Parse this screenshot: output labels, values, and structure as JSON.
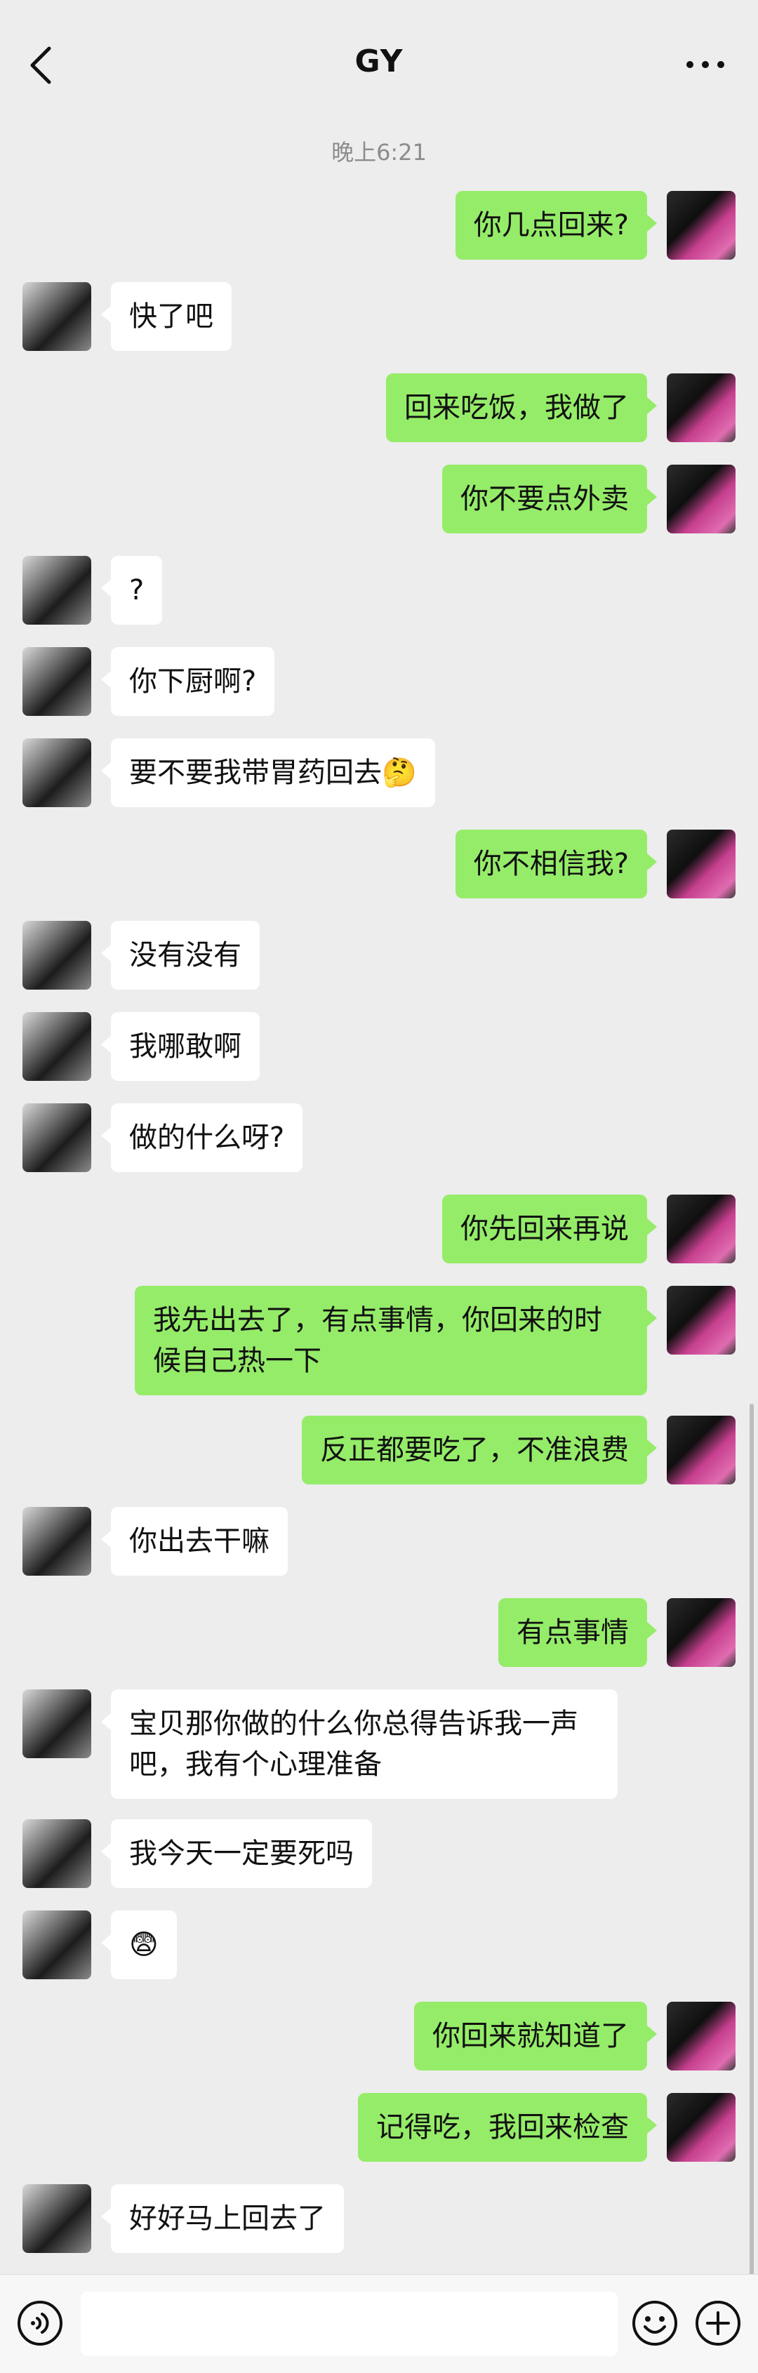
{
  "header": {
    "title": "GY"
  },
  "chat": {
    "timestamp": "晚上6:21",
    "messages": [
      {
        "side": "out",
        "text": "你几点回来?"
      },
      {
        "side": "in",
        "text": "快了吧"
      },
      {
        "side": "out",
        "text": "回来吃饭，我做了"
      },
      {
        "side": "out",
        "text": "你不要点外卖"
      },
      {
        "side": "in",
        "text": "?"
      },
      {
        "side": "in",
        "text": "你下厨啊?"
      },
      {
        "side": "in",
        "text": "要不要我带胃药回去🤔"
      },
      {
        "side": "out",
        "text": "你不相信我?"
      },
      {
        "side": "in",
        "text": "没有没有"
      },
      {
        "side": "in",
        "text": "我哪敢啊"
      },
      {
        "side": "in",
        "text": "做的什么呀?"
      },
      {
        "side": "out",
        "text": "你先回来再说"
      },
      {
        "side": "out",
        "text": "我先出去了，有点事情，你回来的时候自己热一下"
      },
      {
        "side": "out",
        "text": "反正都要吃了，不准浪费"
      },
      {
        "side": "in",
        "text": "你出去干嘛"
      },
      {
        "side": "out",
        "text": "有点事情"
      },
      {
        "side": "in",
        "text": "宝贝那你做的什么你总得告诉我一声吧，我有个心理准备"
      },
      {
        "side": "in",
        "text": "我今天一定要死吗"
      },
      {
        "side": "in",
        "text": "😨"
      },
      {
        "side": "out",
        "text": "你回来就知道了"
      },
      {
        "side": "out",
        "text": "记得吃，我回来检查"
      },
      {
        "side": "in",
        "text": "好好马上回去了"
      }
    ]
  },
  "input": {
    "value": "",
    "placeholder": ""
  },
  "colors": {
    "background": "#ededed",
    "outgoing_bubble": "#95ec69",
    "incoming_bubble": "#ffffff"
  },
  "icons": {
    "back": "chevron-left-icon",
    "more": "more-dots-icon",
    "voice": "voice-icon",
    "emoji": "emoji-icon",
    "plus": "plus-icon"
  }
}
